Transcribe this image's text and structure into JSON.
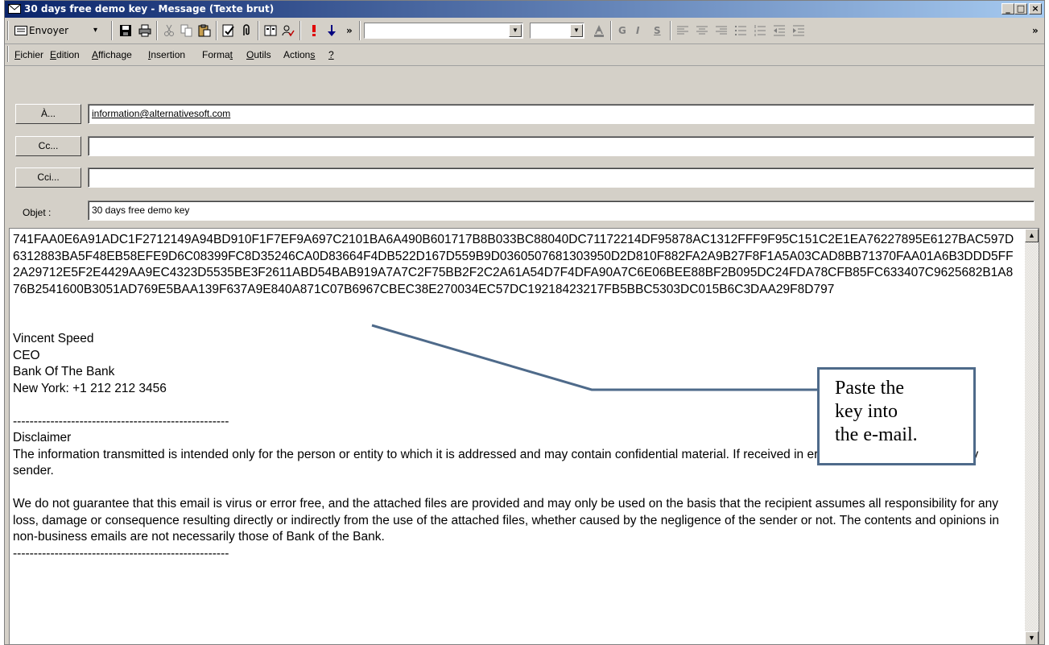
{
  "window": {
    "title": "30 days free demo key - Message (Texte brut)",
    "controls": {
      "minimize": "_",
      "maximize": "□",
      "close": "×"
    }
  },
  "toolbar": {
    "send_label": "Envoyer",
    "send_dropdown": "▾",
    "more": "»",
    "font_combo": "",
    "size_combo": "",
    "bold": "G",
    "italic": "I",
    "underline": "S",
    "icons": [
      "message-icon",
      "save-icon",
      "print-icon",
      "cut-icon",
      "copy-icon",
      "paste-icon",
      "check-names-icon",
      "attach-icon",
      "address-book-icon",
      "spelling-icon",
      "high-importance-icon",
      "low-importance-icon",
      "font-color-icon",
      "align-left-icon",
      "center-icon",
      "align-right-icon",
      "bullets-icon",
      "numbering-icon",
      "decrease-indent-icon",
      "increase-indent-icon"
    ]
  },
  "menu": {
    "items": [
      {
        "pre": "",
        "key": "F",
        "post": "ichier"
      },
      {
        "pre": "",
        "key": "E",
        "post": "dition"
      },
      {
        "pre": "",
        "key": "A",
        "post": "ffichage"
      },
      {
        "pre": "",
        "key": "I",
        "post": "nsertion"
      },
      {
        "pre": "Forma",
        "key": "t",
        "post": ""
      },
      {
        "pre": "",
        "key": "O",
        "post": "utils"
      },
      {
        "pre": "Action",
        "key": "s",
        "post": ""
      },
      {
        "pre": "",
        "key": "?",
        "post": ""
      }
    ]
  },
  "header": {
    "to_button": "À...",
    "to_value": "information@alternativesoft.com",
    "cc_button": "Cc...",
    "cc_value": "",
    "bcc_button": "Cci...",
    "bcc_value": "",
    "subject_label": "Objet :",
    "subject_value": "30 days free demo key"
  },
  "body": {
    "key": "741FAA0E6A91ADC1F2712149A94BD910F1F7EF9A697C2101BA6A490B601717B8B033BC88040DC71172214DF95878AC1312FFF9F95C151C2E1EA76227895E6127BAC597D6312883BA5F48EB58EFE9D6C08399FC8D35246CA0D83664F4DB522D167D559B9D0360507681303950D2D810F882FA2A9B27F8F1A5A03CAD8BB71370FAA01A6B3DDD5FF2A29712E5F2E4429AA9EC4323D5535BE3F2611ABD54BAB919A7A7C2F75BB2F2C2A61A54D7F4DFA90A7C6E06BEE88BF2B095DC24FDA78CFB85FC633407C9625682B1A876B2541600B3051AD769E5BAA139F637A9E840A871C07B6967CBEC38E270034EC57DC19218423217FB5BBC5303DC015B6C3DAA29F8D797",
    "sig_name": "Vincent Speed",
    "sig_title": "CEO",
    "sig_company": "Bank Of The Bank",
    "sig_phone": "New York: +1 212 212 3456",
    "divider": "----------------------------------------------------",
    "disclaimer_title": "Disclaimer",
    "disclaimer_p1": "The information transmitted is intended only for the person or entity to which it is addressed and may contain confidential material. If received in error, please destroy and notify sender.",
    "disclaimer_p2": "We do not guarantee that this email is virus or error free, and the attached files are provided and may only be used on the basis that the recipient assumes all responsibility for any loss, damage or consequence resulting directly or indirectly from the use of the attached files, whether caused by the negligence of the sender or not. The contents and opinions in non-business emails are not necessarily those of Bank of the Bank."
  },
  "scrollbar": {
    "up": "▲",
    "down": "▼"
  },
  "callout": {
    "line1": "Paste the",
    "line2": "key into",
    "line3": "the e-mail."
  },
  "colors": {
    "titlebar_start": "#0a246a",
    "titlebar_end": "#a6caf0",
    "face": "#d4d0c8",
    "callout_border": "#4e6a8a"
  }
}
